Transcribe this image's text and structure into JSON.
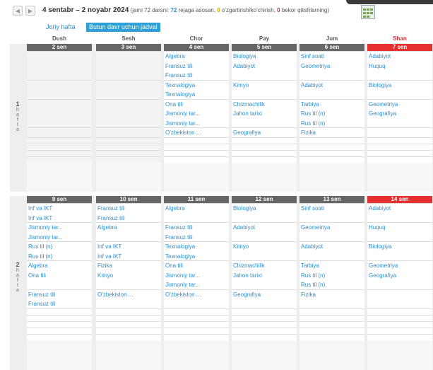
{
  "period": {
    "range": "4 sentabr – 2 noyabr 2024",
    "open": "(jami 72 darsni: ",
    "planned": "72",
    "planned_text": " rejaga asosan, ",
    "changed": "0",
    "changed_text": " o'zgartirish/ko'chirish, ",
    "cancelled": "0",
    "cancelled_text": " bekor qilishlarning)"
  },
  "tabs": [
    {
      "label": "Joriy hafta"
    },
    {
      "label": "Butun davr uchun jadval"
    }
  ],
  "days": [
    {
      "label": "Dush"
    },
    {
      "label": "Sesh"
    },
    {
      "label": "Chor"
    },
    {
      "label": "Pay"
    },
    {
      "label": "Jum"
    },
    {
      "label": "Shan"
    }
  ],
  "weeks": [
    {
      "num": "1",
      "word": [
        "h",
        "a",
        "f",
        "t",
        "a"
      ],
      "dates": [
        "2 sen",
        "3 sen",
        "4 sen",
        "5 sen",
        "6 sen",
        "7 sen"
      ],
      "slots": [
        [
          [],
          [],
          [
            "Algebra",
            "Fransuz tili",
            "Fransuz tili"
          ],
          [
            "Biologiya",
            "Adabiyot"
          ],
          [
            "Sinf soati",
            "Geometriya"
          ],
          [
            "Adabiyot",
            "Huquq"
          ]
        ],
        [
          [],
          [],
          [
            "Texnalogiya",
            "Texnalogiya"
          ],
          [
            "Kimyo"
          ],
          [
            "Adabiyot"
          ],
          [
            "Biologiya"
          ]
        ],
        [
          [],
          [],
          [
            "Ona tili",
            "Jismoniy tar...",
            "Jismoniy tar..."
          ],
          [
            "Chizmachilik",
            "Jahon tarixi"
          ],
          [
            "Tarbiya",
            "Rus til (n)",
            "Rus til (n)"
          ],
          [
            "Geometriya",
            "Geografiya"
          ]
        ],
        [
          [],
          [],
          [
            "O'zbekiston ..."
          ],
          [
            "Geografiya"
          ],
          [
            "Fizika"
          ],
          []
        ]
      ]
    },
    {
      "num": "2",
      "word": [
        "h",
        "a",
        "f",
        "t",
        "a"
      ],
      "dates": [
        "9 sen",
        "10 sen",
        "11 sen",
        "12 sen",
        "13 sen",
        "14 sen"
      ],
      "slots": [
        [
          [
            "Inf va IKT",
            "Inf va IKT"
          ],
          [
            "Fransuz tili",
            "Fransuz tili"
          ],
          [
            "Algebra"
          ],
          [
            "Biologiya"
          ],
          [
            "Sinf soati"
          ],
          [
            "Adabiyot"
          ]
        ],
        [
          [
            "Jismoniy tar...",
            "Jismoniy tar..."
          ],
          [
            "Algebra"
          ],
          [
            "Fransuz tili",
            "Fransuz tili"
          ],
          [
            "Adabiyot"
          ],
          [
            "Geometriya"
          ],
          [
            "Huquq"
          ]
        ],
        [
          [
            "Rus til (n)",
            "Rus til (n)"
          ],
          [
            "Inf va IKT",
            "Inf va IKT"
          ],
          [
            "Texnalogiya",
            "Texnalogiya"
          ],
          [
            "Kimyo"
          ],
          [
            "Adabiyot"
          ],
          [
            "Biologiya"
          ]
        ],
        [
          [
            "Algebra",
            "Ona tili"
          ],
          [
            "Fizika",
            "Kimyo"
          ],
          [
            "Ona tili",
            "Jismoniy tar...",
            "Jismoniy tar..."
          ],
          [
            "Chizmachilik",
            "Jahon tarixi"
          ],
          [
            "Tarbiya",
            "Rus til (n)",
            "Rus til (n)"
          ],
          [
            "Geometriya",
            "Geografiya"
          ]
        ],
        [
          [
            "Fransuz tili",
            "Fransuz tili"
          ],
          [
            "O'zbekiston ..."
          ],
          [
            "O'zbekiston ..."
          ],
          [
            "Geografiya"
          ],
          [
            "Fizika"
          ],
          []
        ]
      ]
    }
  ],
  "colors": {
    "accent": "#2a8fd0",
    "holiday": "#e63030",
    "datebar": "#666666"
  },
  "icons": {
    "prev": "chevron-left-icon",
    "next": "chevron-right-icon",
    "calendar": "calendar-icon"
  }
}
